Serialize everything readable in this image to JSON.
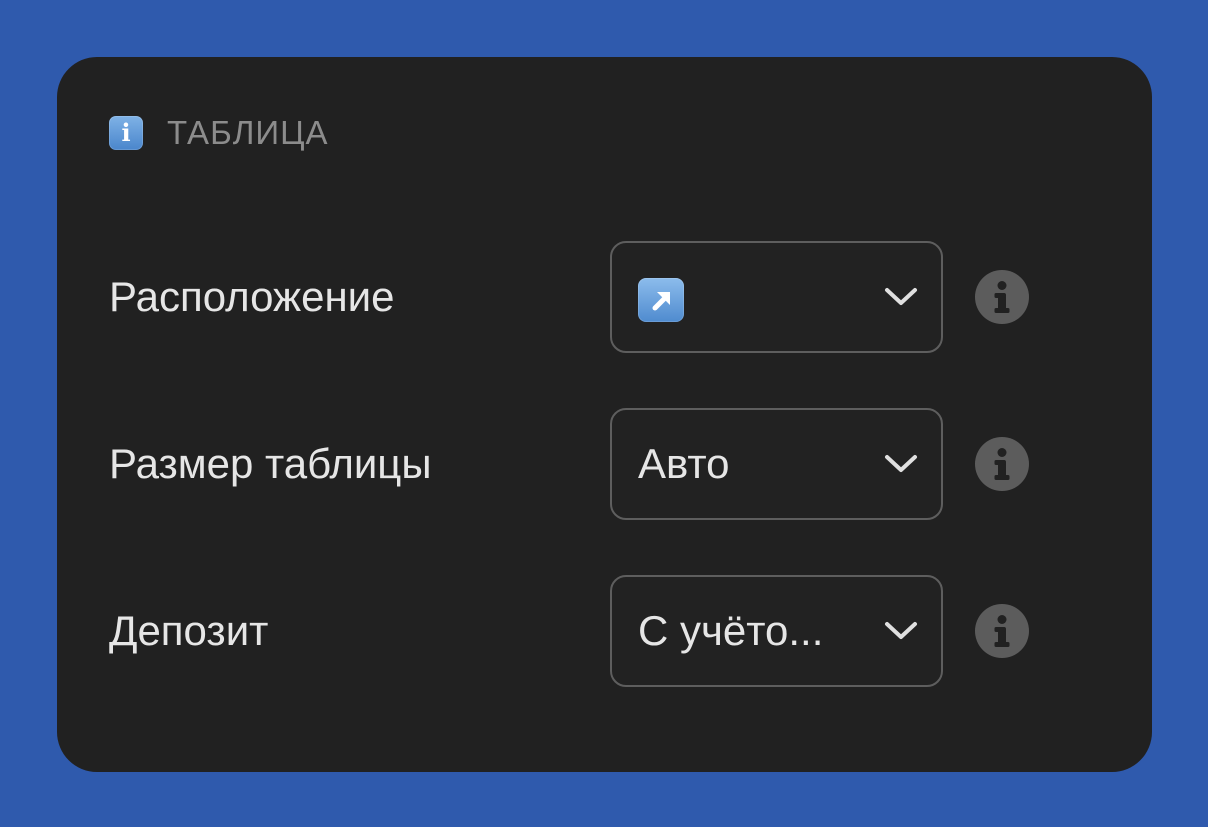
{
  "section": {
    "title": "ТАБЛИЦА",
    "icon": "information-emoji-icon",
    "icon_glyph": "i"
  },
  "rows": [
    {
      "label": "Расположение",
      "select_value": "",
      "select_icon": "up-right-arrow-emoji-icon",
      "info_icon": "info-circle-icon"
    },
    {
      "label": "Размер таблицы",
      "select_value": "Авто",
      "info_icon": "info-circle-icon"
    },
    {
      "label": "Депозит",
      "select_value": "С учёто...",
      "info_icon": "info-circle-icon"
    }
  ],
  "colors": {
    "background": "#2f5aad",
    "panel": "#212121",
    "text": "#e6e6e6",
    "muted_text": "#8c8c8c",
    "border": "#5e5e5e",
    "info_icon": "#5c5c5c",
    "emoji_blue": "#5b95d4"
  }
}
